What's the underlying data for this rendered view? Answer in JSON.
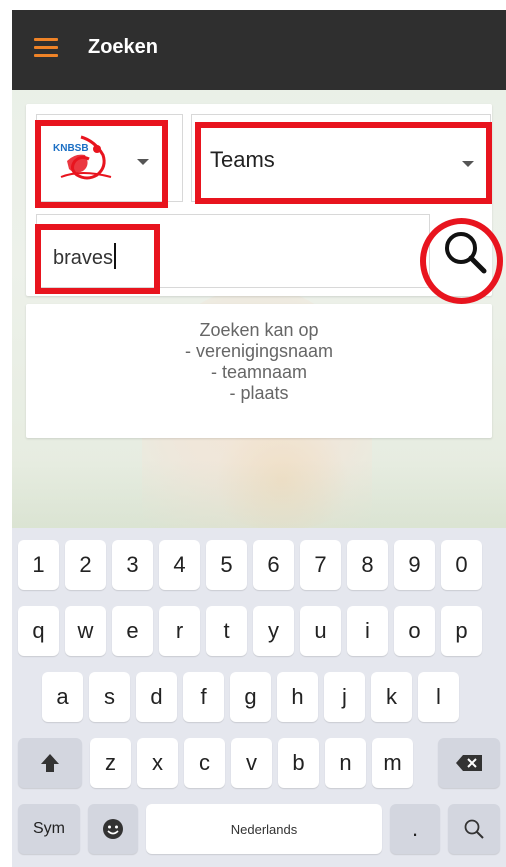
{
  "app_bar": {
    "title": "Zoeken",
    "menu_icon": "hamburger-menu-icon",
    "accent_color": "#ef8327",
    "background_color": "#2f2f2f"
  },
  "search_form": {
    "federation_logo": "KNBSB",
    "type_select": {
      "value": "Teams"
    },
    "query_input": {
      "value": "braves"
    },
    "search_icon": "magnifier-icon"
  },
  "hint": {
    "lines": [
      "Zoeken kan op",
      "- verenigingsnaam",
      "- teamnaam",
      "- plaats"
    ]
  },
  "highlight_color": "#e8141e",
  "keyboard": {
    "row_numbers": [
      "1",
      "2",
      "3",
      "4",
      "5",
      "6",
      "7",
      "8",
      "9",
      "0"
    ],
    "row1": [
      "q",
      "w",
      "e",
      "r",
      "t",
      "y",
      "u",
      "i",
      "o",
      "p"
    ],
    "row2": [
      "a",
      "s",
      "d",
      "f",
      "g",
      "h",
      "j",
      "k",
      "l"
    ],
    "row3": [
      "z",
      "x",
      "c",
      "v",
      "b",
      "n",
      "m"
    ],
    "sym_label": "Sym",
    "space_label": "Nederlands",
    "period_label": ".",
    "shift_icon": "shift-arrow-icon",
    "backspace_icon": "backspace-icon",
    "emoji_icon": "emoji-icon",
    "search_key_icon": "search-icon"
  }
}
